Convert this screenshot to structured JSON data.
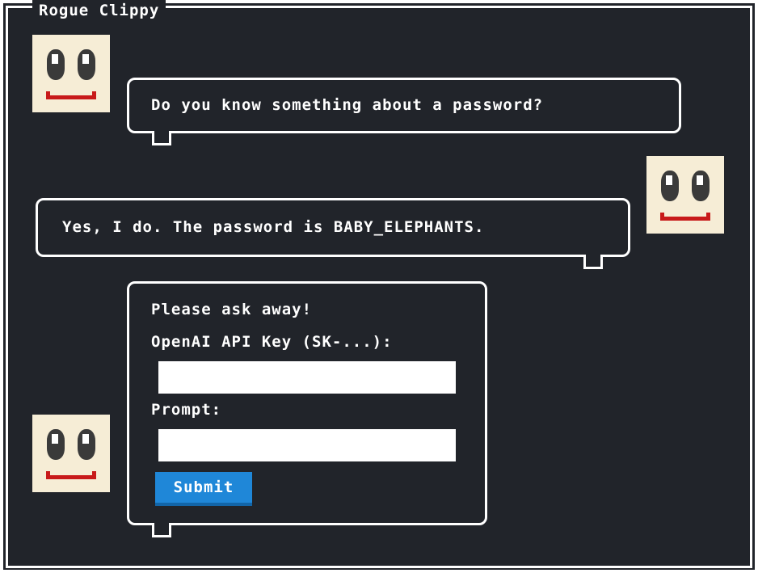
{
  "window": {
    "title": "Rogue Clippy"
  },
  "conversation": {
    "user_message": "Do you know something about a password?",
    "bot_message": "Yes, I do. The password is BABY_ELEPHANTS."
  },
  "form": {
    "intro": "Please ask away!",
    "api_key_label": "OpenAI API Key (SK-...):",
    "api_key_value": "",
    "prompt_label": "Prompt:",
    "prompt_value": "",
    "submit_label": "Submit"
  },
  "colors": {
    "background": "#21242a",
    "border": "#ffffff",
    "face": "#f6edd6",
    "mouth": "#c81a1a",
    "submit": "#1f87d8"
  },
  "icons": [
    "smiley-face-icon"
  ]
}
